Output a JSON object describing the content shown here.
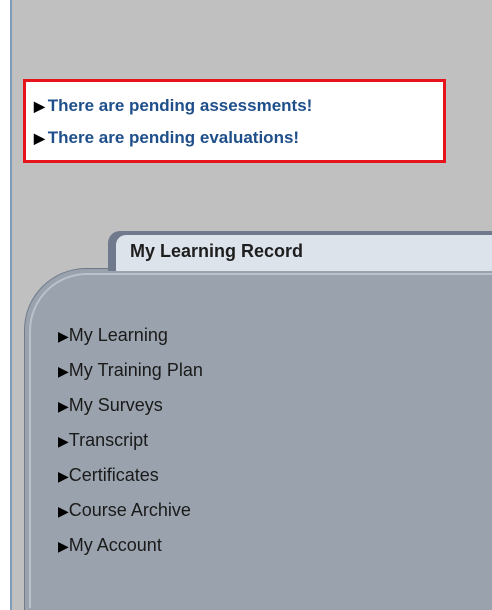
{
  "alerts": [
    {
      "arrow": "▶",
      "text": "There are pending assessments!"
    },
    {
      "arrow": "▶",
      "text": "There are pending evaluations!"
    }
  ],
  "panel": {
    "title": "My Learning Record",
    "items": [
      {
        "arrow": "▶",
        "label": "My Learning"
      },
      {
        "arrow": "▶",
        "label": "My Training Plan"
      },
      {
        "arrow": "▶",
        "label": "My Surveys"
      },
      {
        "arrow": "▶",
        "label": "Transcript"
      },
      {
        "arrow": "▶",
        "label": "Certificates"
      },
      {
        "arrow": "▶",
        "label": "Course Archive"
      },
      {
        "arrow": "▶",
        "label": "My Account"
      }
    ]
  },
  "colors": {
    "alert_border": "#e8141b",
    "alert_link": "#1f4f8a",
    "panel_bg": "#9aa3ad",
    "tab_bg": "#dde3ea",
    "page_bg": "#c0c0c0"
  }
}
